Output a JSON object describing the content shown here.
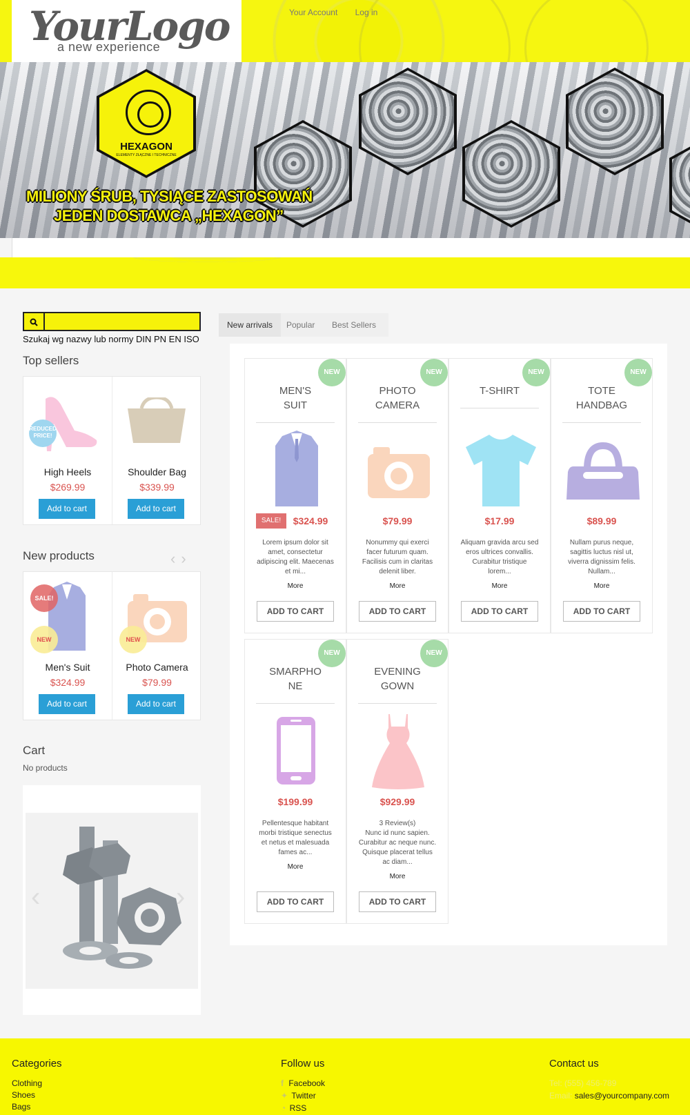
{
  "header": {
    "logo_main": "YourLogo",
    "logo_sub": "a new experience",
    "links": [
      "Your Account",
      "Log in"
    ]
  },
  "banner": {
    "hex_brand": "HEXAGON",
    "hex_brand_sub": "ELEMENTY ZŁĄCZNE I TECHNICZNE",
    "line1": "MILIONY ŚRUB, TYSIĄCE ZASTOSOWAŃ",
    "line2": "JEDEN DOSTAWCA „HEXAGON”"
  },
  "search": {
    "icon": "search-icon",
    "hint": "Szukaj wg nazwy lub normy DIN PN EN ISO"
  },
  "top_sellers": {
    "title": "Top sellers",
    "items": [
      {
        "name": "High Heels",
        "price": "$269.99",
        "button": "Add to cart",
        "badge": "REDUCED PRICE!"
      },
      {
        "name": "Shoulder Bag",
        "price": "$339.99",
        "button": "Add to cart"
      }
    ]
  },
  "new_products": {
    "title": "New products",
    "items": [
      {
        "name": "Men's Suit",
        "price": "$324.99",
        "button": "Add to cart",
        "sale": "SALE!",
        "new": "NEW"
      },
      {
        "name": "Photo Camera",
        "price": "$79.99",
        "button": "Add to cart",
        "new": "NEW"
      }
    ]
  },
  "cart": {
    "title": "Cart",
    "empty": "No products"
  },
  "tabs": [
    "New arrivals",
    "Popular",
    "Best Sellers"
  ],
  "products": [
    {
      "title": "MEN'S SUIT",
      "price": "$324.99",
      "sale": "SALE!",
      "desc": "Lorem ipsum dolor sit amet, consectetur adipiscing elit. Maecenas et mi...",
      "more": "More",
      "button": "ADD TO CART",
      "badge": "NEW"
    },
    {
      "title": "PHOTO CAMERA",
      "price": "$79.99",
      "desc": "Nonummy qui exerci facer futurum quam. Facilisis cum in claritas delenit liber.",
      "more": "More",
      "button": "ADD TO CART",
      "badge": "NEW"
    },
    {
      "title": "T-SHIRT",
      "price": "$17.99",
      "desc": "Aliquam gravida arcu sed eros ultrices convallis. Curabitur tristique lorem...",
      "more": "More",
      "button": "ADD TO CART",
      "badge": "NEW"
    },
    {
      "title": "TOTE HANDBAG",
      "price": "$89.99",
      "desc": "Nullam purus neque, sagittis luctus nisl ut, viverra dignissim felis. Nullam...",
      "more": "More",
      "button": "ADD TO CART",
      "badge": "NEW"
    },
    {
      "title": "SMARPHONE",
      "price": "$199.99",
      "desc": "Pellentesque habitant morbi tristique senectus et netus et malesuada fames ac...",
      "more": "More",
      "button": "ADD TO CART",
      "badge": "NEW"
    },
    {
      "title": "EVENING GOWN",
      "price": "$929.99",
      "reviews": "3 Review(s)",
      "desc": "Nunc id nunc sapien. Curabitur ac neque nunc. Quisque placerat tellus ac diam...",
      "more": "More",
      "button": "ADD TO CART",
      "badge": "NEW"
    }
  ],
  "footer": {
    "categories_title": "Categories",
    "categories": [
      "Clothing",
      "Shoes",
      "Bags"
    ],
    "follow_title": "Follow us",
    "follow": [
      "Facebook",
      "Twitter",
      "RSS"
    ],
    "contact_title": "Contact us",
    "tel": "Tel: (555) 456-789",
    "email_label": "Email:",
    "email": "sales@yourcompany.com"
  },
  "colors": {
    "brand_yellow": "#f7f700",
    "price_red": "#d9534f",
    "button_blue": "#2a9fd6",
    "new_badge": "#a6dba8"
  }
}
